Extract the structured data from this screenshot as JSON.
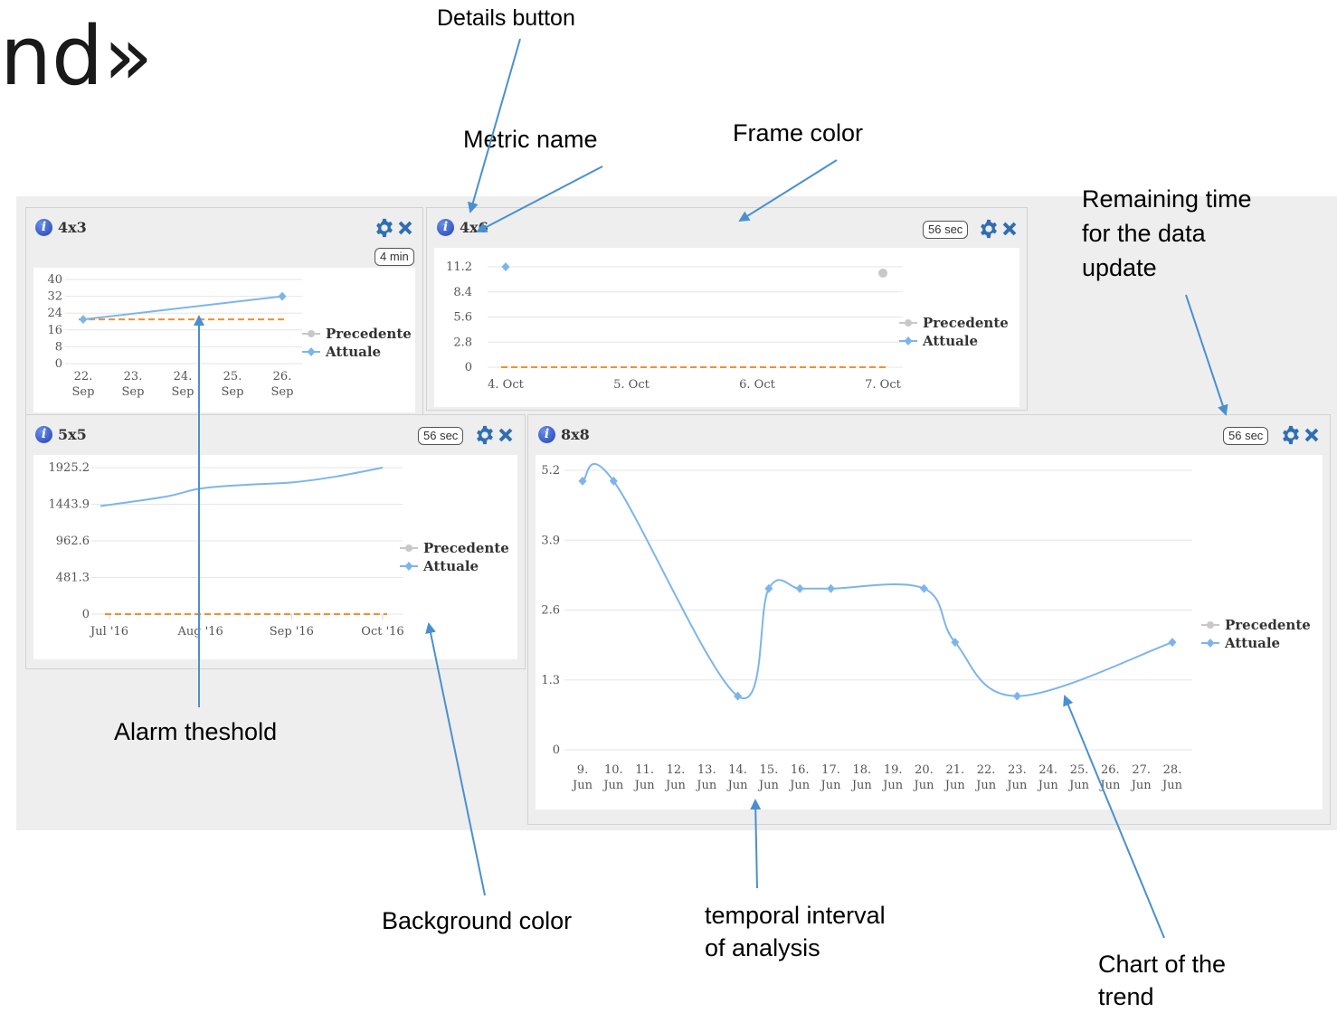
{
  "slide": {
    "title_fragment": "nd»"
  },
  "annotations": {
    "details_button": "Details button",
    "metric_name": "Metric name",
    "frame_color": "Frame color",
    "remaining_time": [
      "Remaining time",
      "for the data",
      "update"
    ],
    "alarm_threshold": "Alarm theshold",
    "background_color": "Background color",
    "temporal_interval": [
      "temporal interval",
      "of analysis"
    ],
    "chart_of_trend": [
      "Chart of the",
      "trend"
    ]
  },
  "colors": {
    "series_line": "#7cb5ec",
    "threshold": "#f0912f",
    "previous_marker": "#c8c8c8",
    "widget_background": "#eeeeee",
    "icon_blue": "#2f6fb0"
  },
  "icons": {
    "info": "info-icon",
    "settings": "gear-icon",
    "close": "close-icon"
  },
  "legend": {
    "previous": "Precedente",
    "current": "Attuale"
  },
  "widgets": {
    "w1": {
      "metric": "4x3",
      "timer": "4 min",
      "info_glyph": "i"
    },
    "w2": {
      "metric": "4x6",
      "timer": "56 sec",
      "info_glyph": "i"
    },
    "w3": {
      "metric": "5x5",
      "timer": "56 sec",
      "info_glyph": "i"
    },
    "w4": {
      "metric": "8x8",
      "timer": "56 sec",
      "info_glyph": "i"
    }
  },
  "chart_data": [
    {
      "type": "line",
      "metric": "4x3",
      "categories": [
        "22. Sep",
        "23. Sep",
        "24. Sep",
        "25. Sep",
        "26. Sep"
      ],
      "y_ticks": [
        "0",
        "8",
        "16",
        "24",
        "32",
        "40"
      ],
      "ylim": [
        0,
        40
      ],
      "series": [
        {
          "name": "Precedente",
          "values": []
        },
        {
          "name": "Attuale",
          "points": [
            [
              0,
              21
            ],
            [
              4,
              32
            ]
          ]
        }
      ],
      "threshold": 21
    },
    {
      "type": "line",
      "metric": "4x6",
      "categories": [
        "4. Oct",
        "5. Oct",
        "6. Oct",
        "7. Oct"
      ],
      "y_ticks": [
        "0",
        "2.8",
        "5.6",
        "8.4",
        "11.2"
      ],
      "ylim": [
        0,
        11.2
      ],
      "series": [
        {
          "name": "Precedente",
          "points": [
            [
              3,
              10.5
            ]
          ]
        },
        {
          "name": "Attuale",
          "points": [
            [
              0,
              11.2
            ]
          ]
        }
      ],
      "threshold": 0
    },
    {
      "type": "line",
      "metric": "5x5",
      "categories": [
        "Jul '16",
        "Aug '16",
        "Sep '16",
        "Oct '16"
      ],
      "y_ticks": [
        "0",
        "481.3",
        "962.6",
        "1443.9",
        "1925.2"
      ],
      "ylim": [
        0,
        1925.2
      ],
      "series": [
        {
          "name": "Precedente",
          "values": []
        },
        {
          "name": "Attuale",
          "points": [
            [
              -0.1,
              1420
            ],
            [
              0.6,
              1540
            ],
            [
              1.0,
              1650
            ],
            [
              1.5,
              1700
            ],
            [
              2.0,
              1730
            ],
            [
              2.5,
              1810
            ],
            [
              3.0,
              1925.2
            ]
          ]
        }
      ],
      "threshold": 0
    },
    {
      "type": "line",
      "metric": "8x8",
      "categories": [
        "9. Jun",
        "10. Jun",
        "11. Jun",
        "12. Jun",
        "13. Jun",
        "14. Jun",
        "15. Jun",
        "16. Jun",
        "17. Jun",
        "18. Jun",
        "19. Jun",
        "20. Jun",
        "21. Jun",
        "22. Jun",
        "23. Jun",
        "24. Jun",
        "25. Jun",
        "26. Jun",
        "27. Jun",
        "28. Jun"
      ],
      "y_ticks": [
        "0",
        "1.3",
        "2.6",
        "3.9",
        "5.2"
      ],
      "ylim": [
        0,
        5.2
      ],
      "series": [
        {
          "name": "Precedente",
          "values": []
        },
        {
          "name": "Attuale",
          "points": [
            [
              0,
              5.0
            ],
            [
              1,
              5.0
            ],
            [
              5,
              1.0
            ],
            [
              6,
              3.0
            ],
            [
              7,
              3.0
            ],
            [
              8,
              3.0
            ],
            [
              11,
              3.0
            ],
            [
              12,
              2.0
            ],
            [
              14,
              1.0
            ],
            [
              19,
              2.0
            ]
          ]
        }
      ],
      "threshold": null
    }
  ]
}
